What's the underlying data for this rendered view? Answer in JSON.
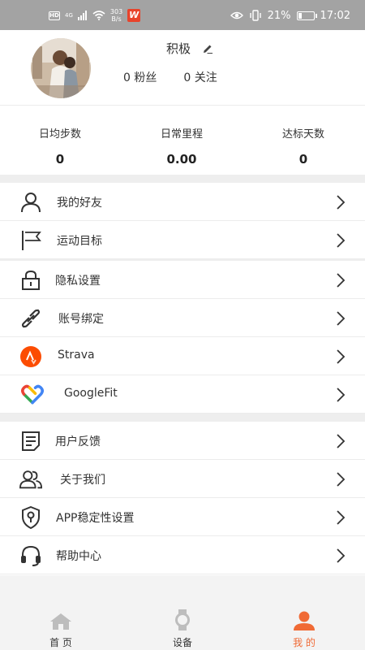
{
  "status_bar": {
    "hd": "HD",
    "network": "4G",
    "speed_value": "303",
    "speed_unit": "B/s",
    "app_badge": "W",
    "battery_percent": "21%",
    "battery_level": 0.21,
    "time": "17:02"
  },
  "profile": {
    "nickname": "积极",
    "fans_count": "0",
    "fans_label": "粉丝",
    "following_count": "0",
    "following_label": "关注"
  },
  "stats": [
    {
      "label": "日均步数",
      "value": "0"
    },
    {
      "label": "日常里程",
      "value": "0.00"
    },
    {
      "label": "达标天数",
      "value": "0"
    }
  ],
  "menu": {
    "friends": "我的好友",
    "goal": "运动目标",
    "privacy": "隐私设置",
    "binding": "账号绑定",
    "strava": "Strava",
    "googlefit": "GoogleFit",
    "feedback": "用户反馈",
    "about": "关于我们",
    "stability": "APP稳定性设置",
    "help": "帮助中心"
  },
  "nav": {
    "home": "首 页",
    "device": "设备",
    "mine": "我 的"
  },
  "colors": {
    "accent": "#f06a35",
    "status_bar": "#a3a3a3",
    "strava": "#fc4c02"
  }
}
